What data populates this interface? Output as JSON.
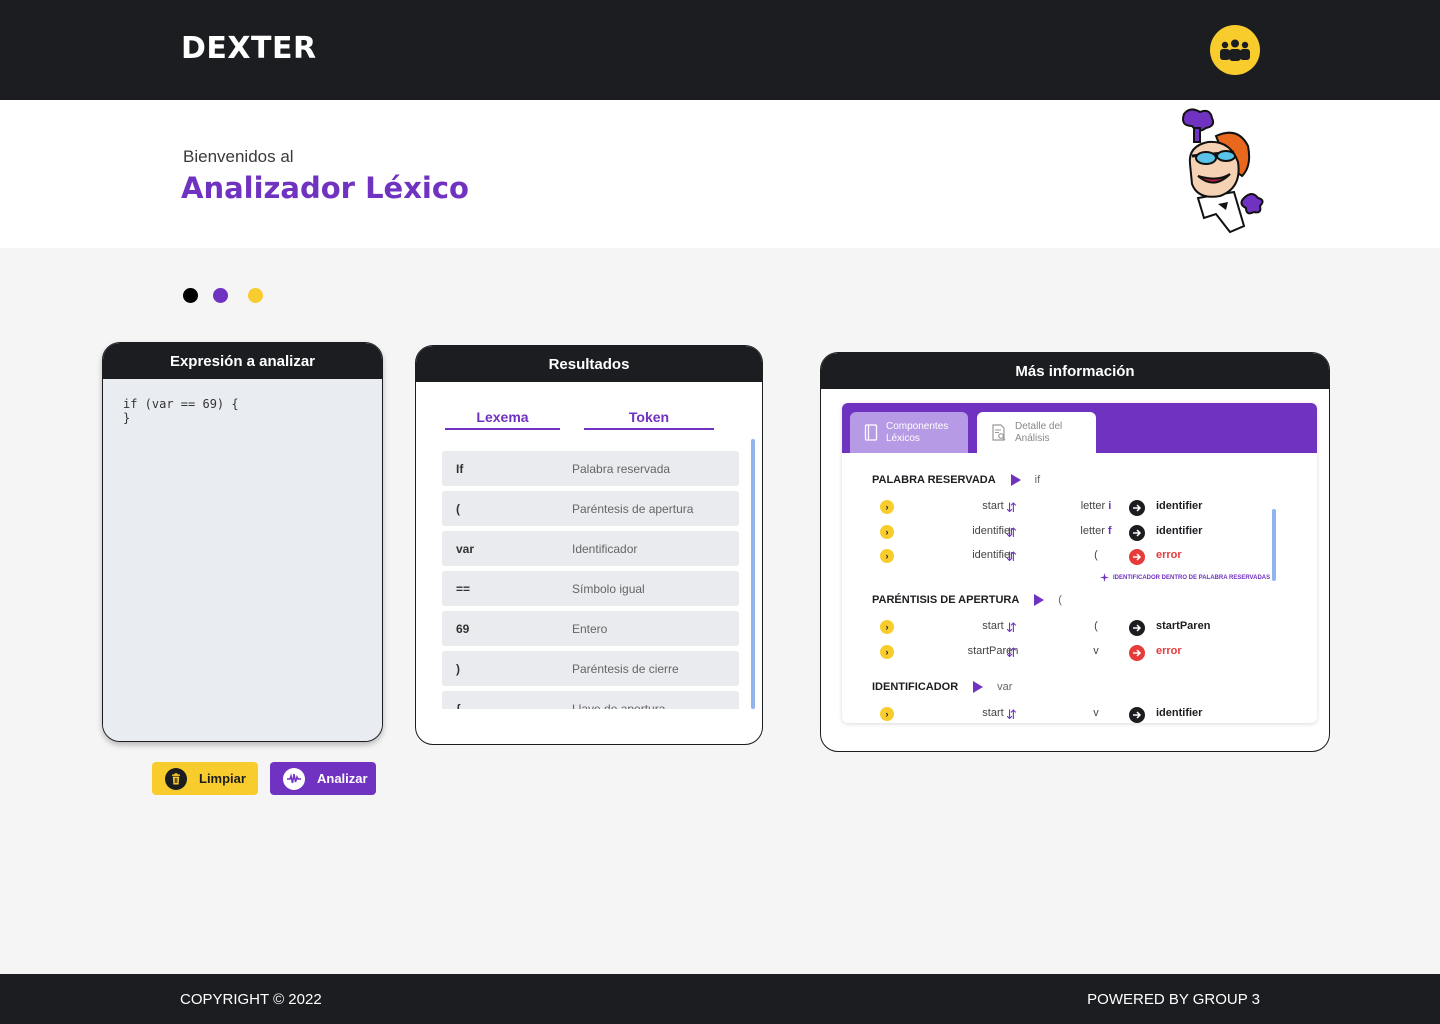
{
  "header": {
    "brand": "DEXTER",
    "team_icon": "group-icon"
  },
  "hero": {
    "subtitle": "Bienvenidos al",
    "title": "Analizador Léxico"
  },
  "theme_dots": [
    "#000000",
    "#7032c0",
    "#f9cc2d"
  ],
  "editor": {
    "title": "Expresión a analizar",
    "code": "if (var == 69) {\n}"
  },
  "buttons": {
    "clear": "Limpiar",
    "analyze": "Analizar"
  },
  "results": {
    "title": "Resultados",
    "col_lexema": "Lexema",
    "col_token": "Token",
    "rows": [
      {
        "lexema": "If",
        "token": "Palabra reservada"
      },
      {
        "lexema": "(",
        "token": "Paréntesis de apertura"
      },
      {
        "lexema": "var",
        "token": "Identificador"
      },
      {
        "lexema": "==",
        "token": "Símbolo igual"
      },
      {
        "lexema": "69",
        "token": "Entero"
      },
      {
        "lexema": ")",
        "token": "Paréntesis de cierre"
      },
      {
        "lexema": "{",
        "token": "Llave de apertura"
      }
    ]
  },
  "info": {
    "title": "Más información",
    "tab_components": [
      "Componentes",
      "Léxicos"
    ],
    "tab_detail": [
      "Detalle del",
      "Análisis"
    ],
    "sections": [
      {
        "title": "PALABRA RESERVADA",
        "lexeme": "if",
        "rows": [
          {
            "state": "start",
            "input_prefix": "letter ",
            "input_char": "i",
            "result": "identifier",
            "error": false
          },
          {
            "state": "identifier",
            "input_prefix": "letter ",
            "input_char": "f",
            "result": "identifier",
            "error": false
          },
          {
            "state": "identifier",
            "input_prefix": "(",
            "input_char": "",
            "result": "error",
            "error": true
          }
        ],
        "note": "IDENTIFICADOR DENTRO DE PALABRA RESERVADAS"
      },
      {
        "title": "PARÉNTISIS DE APERTURA",
        "lexeme": "(",
        "rows": [
          {
            "state": "start",
            "input_prefix": "(",
            "input_char": "",
            "result": "startParen",
            "error": false
          },
          {
            "state": "startParen",
            "input_prefix": "v",
            "input_char": "",
            "result": "error",
            "error": true
          }
        ]
      },
      {
        "title": "IDENTIFICADOR",
        "lexeme": "var",
        "rows": [
          {
            "state": "start",
            "input_prefix": "v",
            "input_char": "",
            "result": "identifier",
            "error": false
          }
        ]
      }
    ]
  },
  "footer": {
    "copyright": "COPYRIGHT © 2022",
    "powered": "POWERED BY GROUP 3"
  }
}
